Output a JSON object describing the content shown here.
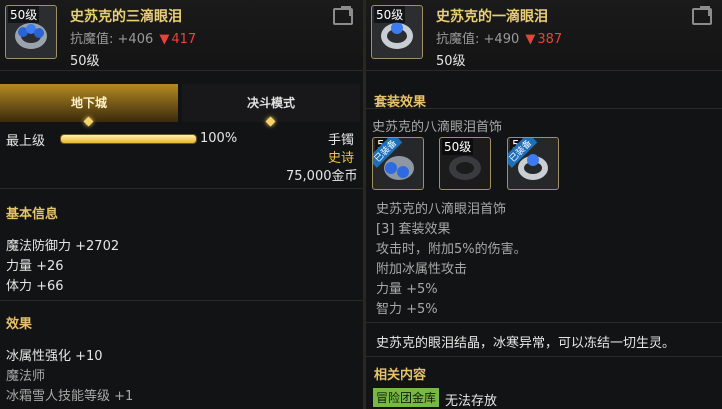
{
  "left": {
    "item": {
      "level_badge": "50级",
      "name": "史苏克的三滴眼泪",
      "stat_label": "抗魔值:",
      "stat_value": "+406",
      "stat_delta": "417",
      "level_text": "50级",
      "icon": "gem-ring-icon"
    },
    "tabs": [
      {
        "label": "地下城",
        "active": true
      },
      {
        "label": "决斗模式",
        "active": false
      }
    ],
    "upgrade": {
      "label": "最上级",
      "percent_text": "100%",
      "progress": 1.0,
      "type": "手镯",
      "rarity": "史诗",
      "price": "75,000金币"
    },
    "basic": {
      "title": "基本信息",
      "lines": [
        "魔法防御力 +2702",
        "力量 +26",
        "体力 +66"
      ]
    },
    "effects": {
      "title": "效果",
      "lines": [
        "冰属性强化 +10",
        "魔法师",
        "冰霜雪人技能等级 +1"
      ]
    }
  },
  "right": {
    "item": {
      "level_badge": "50级",
      "name": "史苏克的一滴眼泪",
      "stat_label": "抗魔值:",
      "stat_value": "+490",
      "stat_delta": "387",
      "level_text": "50级",
      "icon": "gem-ring-icon"
    },
    "set": {
      "title": "套装效果",
      "set_name": "史苏克的八滴眼泪首饰",
      "items": [
        {
          "badge": "5",
          "ribbon": "已装备",
          "icon": "gem-necklace-icon"
        },
        {
          "badge": "50级",
          "ribbon": "",
          "icon": "gem-bracelet-icon"
        },
        {
          "badge": "5",
          "ribbon": "已装备",
          "icon": "gem-ring-icon"
        }
      ],
      "desc_title": "史苏克的八滴眼泪首饰",
      "desc_lines": [
        "[3] 套装效果",
        "攻击时，附加5%的伤害。",
        "附加冰属性攻击",
        "力量 +5%",
        "智力 +5%"
      ]
    },
    "flavor": "史苏克的眼泪结晶，冰寒异常，可以冻结一切生灵。",
    "related": {
      "title": "相关内容",
      "tag": "冒险团金库",
      "note": "无法存放"
    }
  },
  "colors": {
    "gold": "#e9cf74",
    "epic": "#f0c54b",
    "down": "#e8423a",
    "tag": "#78b944"
  }
}
